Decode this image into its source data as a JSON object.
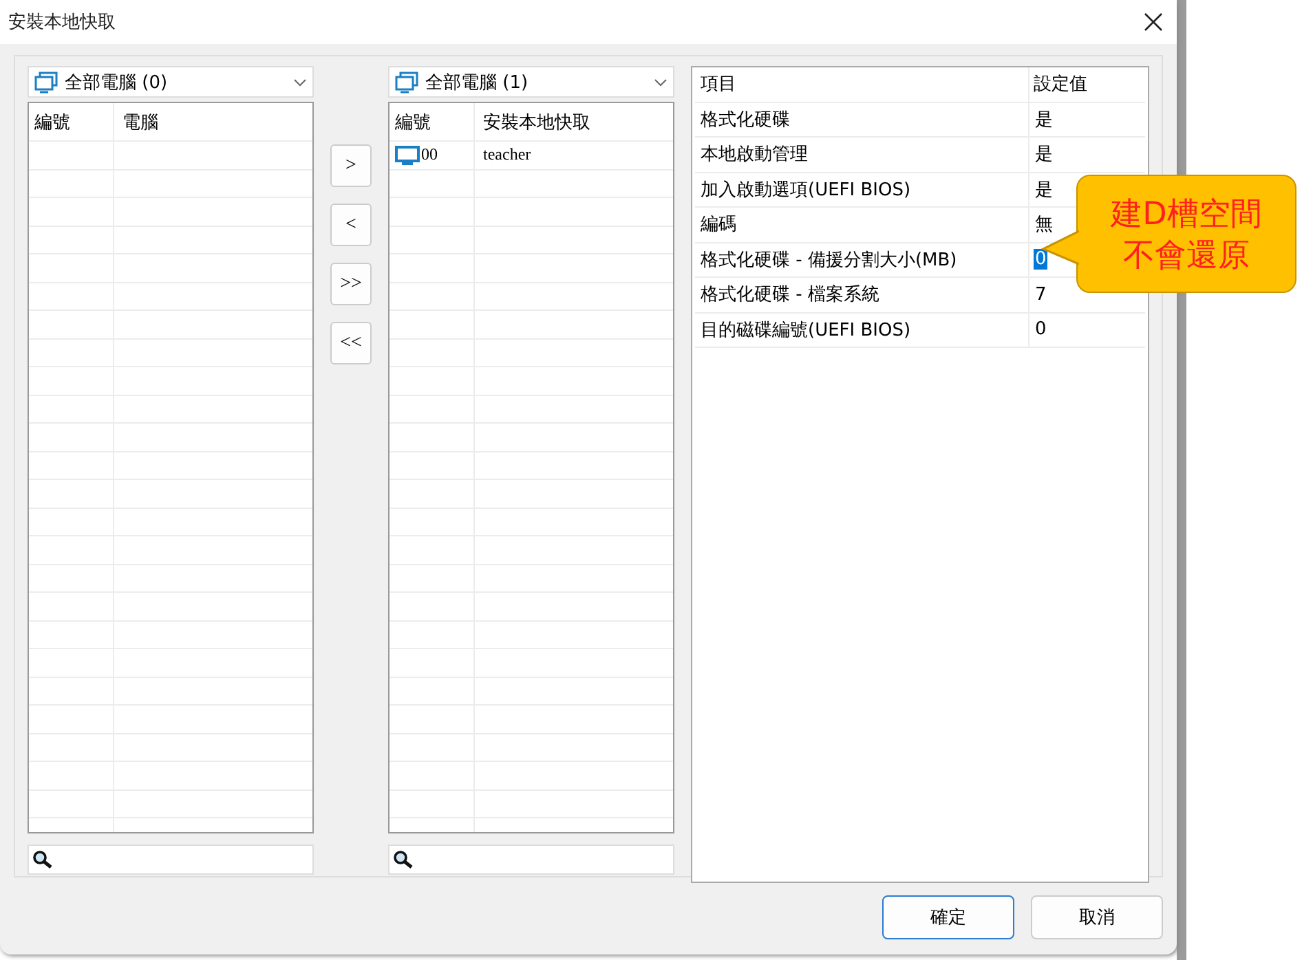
{
  "window": {
    "title": "安裝本地快取"
  },
  "left_list": {
    "dropdown": "全部電腦 (0)",
    "columns": [
      "編號",
      "電腦"
    ]
  },
  "transfer_buttons": [
    ">",
    "<",
    ">>",
    "<<"
  ],
  "right_list": {
    "dropdown": "全部電腦 (1)",
    "columns": [
      "編號",
      "安裝本地快取"
    ],
    "rows": [
      {
        "number": "00",
        "value": "teacher"
      }
    ]
  },
  "settings": {
    "columns": [
      "項目",
      "設定值"
    ],
    "rows": [
      {
        "item": "格式化硬碟",
        "value": "是",
        "selected": false
      },
      {
        "item": "本地啟動管理",
        "value": "是",
        "selected": false
      },
      {
        "item": "加入啟動選項(UEFI BIOS)",
        "value": "是",
        "selected": false
      },
      {
        "item": "編碼",
        "value": "無",
        "selected": false
      },
      {
        "item": "格式化硬碟 - 備援分割大小(MB)",
        "value": "0",
        "selected": true
      },
      {
        "item": "格式化硬碟 - 檔案系統",
        "value": "7",
        "selected": false
      },
      {
        "item": "目的磁碟編號(UEFI BIOS)",
        "value": "0",
        "selected": false
      }
    ]
  },
  "callout": {
    "lines": [
      "建D槽空間",
      "不會還原"
    ]
  },
  "buttons": [
    {
      "label": "確定",
      "default": true
    },
    {
      "label": "取消",
      "default": false
    }
  ]
}
